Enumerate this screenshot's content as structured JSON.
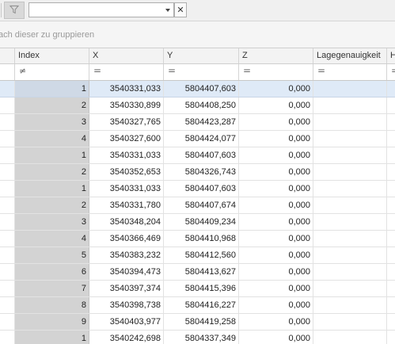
{
  "toolbar": {
    "filter_value": "",
    "clear_label": "✕"
  },
  "group_panel": {
    "hint": "ach dieser zu gruppieren"
  },
  "grid": {
    "columns": [
      "",
      "Index",
      "X",
      "Y",
      "Z",
      "Lagegenauigkeit",
      "H"
    ],
    "filter_symbols": [
      "",
      "≠",
      "=",
      "=",
      "=",
      "=",
      "="
    ],
    "rows": [
      {
        "index": "1",
        "x": "3540331,033",
        "y": "5804407,603",
        "z": "0,000"
      },
      {
        "index": "2",
        "x": "3540330,899",
        "y": "5804408,250",
        "z": "0,000"
      },
      {
        "index": "3",
        "x": "3540327,765",
        "y": "5804423,287",
        "z": "0,000"
      },
      {
        "index": "4",
        "x": "3540327,600",
        "y": "5804424,077",
        "z": "0,000"
      },
      {
        "index": "1",
        "x": "3540331,033",
        "y": "5804407,603",
        "z": "0,000"
      },
      {
        "index": "2",
        "x": "3540352,653",
        "y": "5804326,743",
        "z": "0,000"
      },
      {
        "index": "1",
        "x": "3540331,033",
        "y": "5804407,603",
        "z": "0,000"
      },
      {
        "index": "2",
        "x": "3540331,780",
        "y": "5804407,674",
        "z": "0,000"
      },
      {
        "index": "3",
        "x": "3540348,204",
        "y": "5804409,234",
        "z": "0,000"
      },
      {
        "index": "4",
        "x": "3540366,469",
        "y": "5804410,968",
        "z": "0,000"
      },
      {
        "index": "5",
        "x": "3540383,232",
        "y": "5804412,560",
        "z": "0,000"
      },
      {
        "index": "6",
        "x": "3540394,473",
        "y": "5804413,627",
        "z": "0,000"
      },
      {
        "index": "7",
        "x": "3540397,374",
        "y": "5804415,396",
        "z": "0,000"
      },
      {
        "index": "8",
        "x": "3540398,738",
        "y": "5804416,227",
        "z": "0,000"
      },
      {
        "index": "9",
        "x": "3540403,977",
        "y": "5804419,258",
        "z": "0,000"
      },
      {
        "index": "1",
        "x": "3540242,698",
        "y": "5804337,349",
        "z": "0,000"
      }
    ],
    "selected_row": 0
  }
}
